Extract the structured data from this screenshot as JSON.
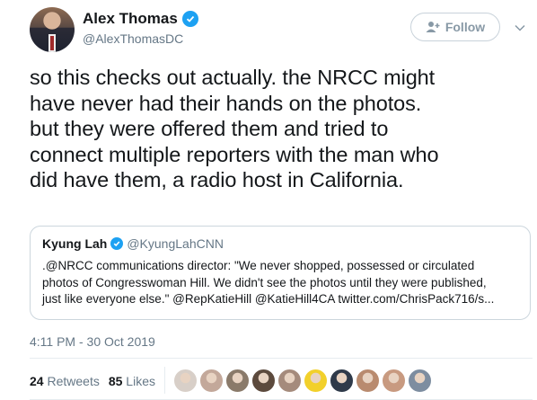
{
  "author": {
    "display_name": "Alex Thomas",
    "handle": "@AlexThomasDC"
  },
  "follow_label": "Follow",
  "tweet_lines": [
    "so this checks out actually. the NRCC might",
    "have never had their hands on the photos.",
    "but they were offered them and tried to",
    "connect multiple reporters with the man who",
    "did have them, a radio host in California."
  ],
  "quoted": {
    "display_name": "Kyung Lah",
    "handle": "@KyungLahCNN",
    "lines": [
      ".@NRCC communications director: \"We never shopped, possessed or circulated",
      "photos of Congresswoman Hill. We didn't see the photos until they were published,",
      "just like everyone else.\" @RepKatieHill @KatieHill4CA twitter.com/ChrisPack716/s..."
    ]
  },
  "timestamp": "4:11 PM - 30 Oct 2019",
  "stats": {
    "retweets_count": "24",
    "retweets_label": "Retweets",
    "likes_count": "85",
    "likes_label": "Likes"
  },
  "likers": [
    "#d8cfc8",
    "#c3a89a",
    "#8a7a6a",
    "#5c4a3d",
    "#a58b7c",
    "#f2d02b",
    "#2f3a4a",
    "#b98b6f",
    "#c89a80",
    "#7d8da0"
  ],
  "colors": {
    "verified": "#1da1f2",
    "secondary_text": "#657786",
    "border": "#ccd6dd"
  }
}
